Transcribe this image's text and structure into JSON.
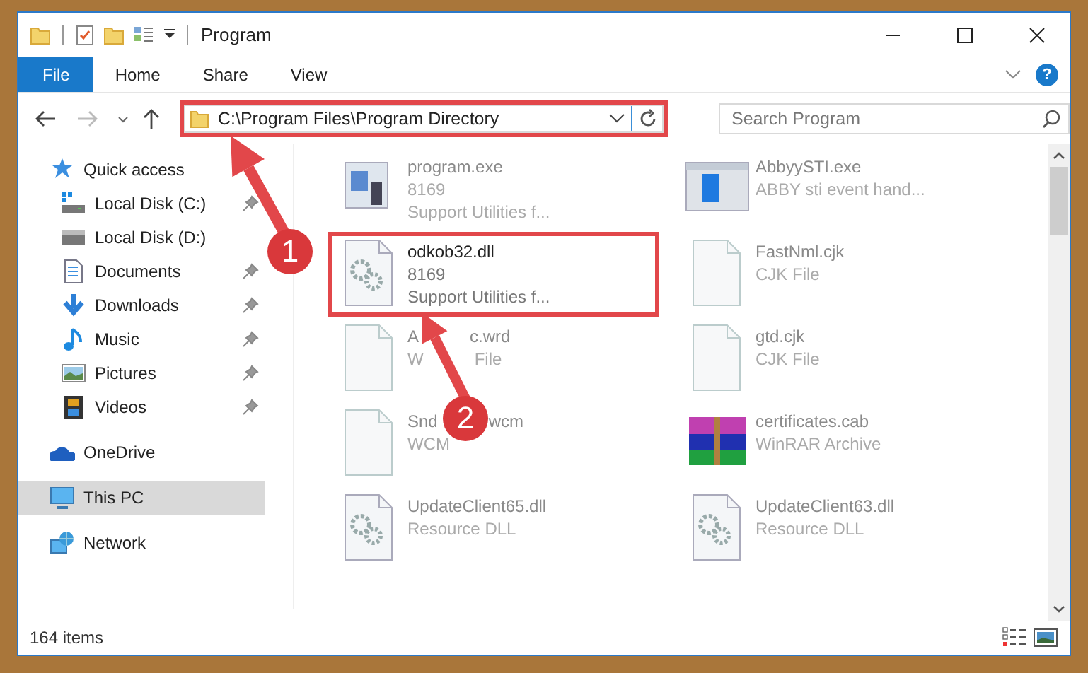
{
  "window": {
    "title": "Program"
  },
  "ribbon": {
    "tabs": [
      {
        "label": "File",
        "selected": true
      },
      {
        "label": "Home",
        "selected": false
      },
      {
        "label": "Share",
        "selected": false
      },
      {
        "label": "View",
        "selected": false
      }
    ],
    "help": "?"
  },
  "address_bar": {
    "path": "C:\\Program Files\\Program Directory",
    "highlighted": true
  },
  "search": {
    "placeholder": "Search Program"
  },
  "sidebar": {
    "items": [
      {
        "label": "Quick access",
        "selected": false,
        "children": [
          {
            "label": "Local Disk (C:)",
            "pinned": true,
            "selected": false
          },
          {
            "label": "Local Disk (D:)",
            "pinned": false,
            "selected": false
          },
          {
            "label": "Documents",
            "pinned": true,
            "selected": false
          },
          {
            "label": "Downloads",
            "pinned": true,
            "selected": false
          },
          {
            "label": "Music",
            "pinned": true,
            "selected": false
          },
          {
            "label": "Pictures",
            "pinned": true,
            "selected": false
          },
          {
            "label": "Videos",
            "pinned": true,
            "selected": false
          }
        ]
      },
      {
        "label": "OneDrive",
        "selected": false
      },
      {
        "label": "This PC",
        "selected": true
      },
      {
        "label": "Network",
        "selected": false
      }
    ]
  },
  "files": [
    {
      "name_parts": [
        "program.exe"
      ],
      "details": [
        [
          "8169"
        ],
        [
          "Support Utilities f..."
        ]
      ],
      "kind": "program",
      "highlighted": false
    },
    {
      "name_parts": [
        "AbbyySTI.exe"
      ],
      "details": [
        [
          "ABBY sti event hand..."
        ]
      ],
      "kind": "app",
      "highlighted": false
    },
    {
      "name_parts": [
        "odkob32.dll"
      ],
      "details": [
        [
          "8169"
        ],
        [
          "Support Utilities f..."
        ]
      ],
      "kind": "gears",
      "highlighted": true
    },
    {
      "name_parts": [
        "FastNml.cjk"
      ],
      "details": [
        [
          "CJK File"
        ]
      ],
      "kind": "blank",
      "highlighted": false
    },
    {
      "name_parts": [
        "A",
        "c.wrd"
      ],
      "details": [
        [
          "W",
          "File"
        ]
      ],
      "kind": "blank",
      "highlighted": false
    },
    {
      "name_parts": [
        "gtd.cjk"
      ],
      "details": [
        [
          "CJK File"
        ]
      ],
      "kind": "blank",
      "highlighted": false
    },
    {
      "name_parts": [
        "Snd",
        "wcm"
      ],
      "details": [
        [
          "WCM"
        ]
      ],
      "kind": "blank",
      "highlighted": false
    },
    {
      "name_parts": [
        "certificates.cab"
      ],
      "details": [
        [
          "WinRAR Archive"
        ]
      ],
      "kind": "archive",
      "highlighted": false
    },
    {
      "name_parts": [
        "UpdateClient65.dll"
      ],
      "details": [
        [
          "Resource DLL"
        ]
      ],
      "kind": "gears",
      "highlighted": false
    },
    {
      "name_parts": [
        "UpdateClient63.dll"
      ],
      "details": [
        [
          "Resource DLL"
        ]
      ],
      "kind": "gears",
      "highlighted": false
    }
  ],
  "status_bar": {
    "item_count": "164 items"
  },
  "annotations": [
    {
      "number": "1"
    },
    {
      "number": "2"
    }
  ]
}
